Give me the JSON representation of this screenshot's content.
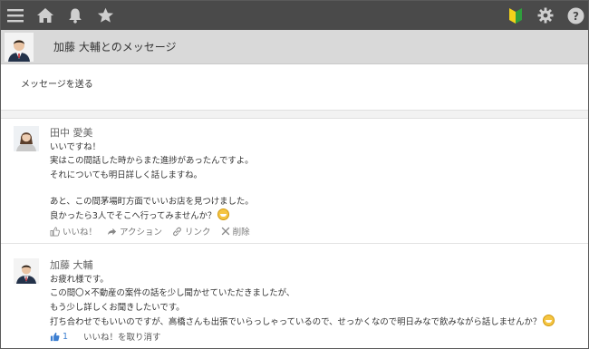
{
  "topbar": {
    "icons": [
      "menu-icon",
      "home-icon",
      "bell-icon",
      "star-icon",
      "beginner-mark-icon",
      "gear-icon",
      "help-icon"
    ]
  },
  "conversation": {
    "title": "加藤 大輔とのメッセージ"
  },
  "composer": {
    "send_label": "メッセージを送る"
  },
  "messages": [
    {
      "author": "田中 愛美",
      "lines": [
        "いいですね！",
        "実はこの間話した時からまた進捗があったんですよ。",
        "それについても明日詳しく話しますね。",
        "",
        "あと、この間茅場町方面でいいお店を見つけました。",
        "良かったら3人でそこへ行ってみませんか？"
      ],
      "actions": {
        "like": "いいね！",
        "action": "アクション",
        "link": "リンク",
        "delete": "削除"
      }
    },
    {
      "author": "加藤 大輔",
      "lines": [
        "お疲れ様です。",
        "この間〇×不動産の案件の話を少し聞かせていただきましたが、",
        "もう少し詳しくお聞きしたいです。",
        "打ち合わせでもいいのですが、高橋さんも出張でいらっしゃっているので、せっかくなので明日みなで飲みながら話しませんか？"
      ],
      "actions": {
        "like_count": "1",
        "unlike": "いいね！を取り消す"
      }
    }
  ],
  "colors": {
    "topbar": "#4a4a4a",
    "titlebar": "#d9d9d9",
    "like_blue": "#3d7fd1"
  }
}
